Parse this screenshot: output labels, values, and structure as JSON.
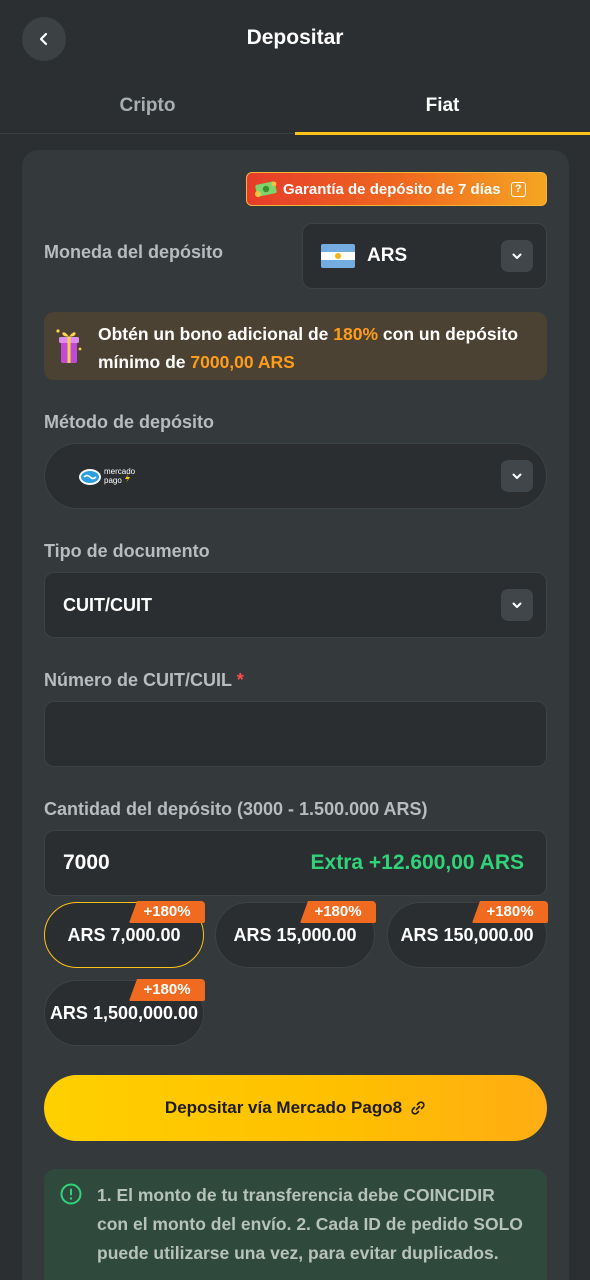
{
  "header": {
    "back_icon": "chevron-left-icon",
    "title": "Depositar"
  },
  "tabs": [
    {
      "label": "Cripto",
      "active": false
    },
    {
      "label": "Fiat",
      "active": true
    }
  ],
  "colors": {
    "accent": "#ffc21a",
    "bonus_highlight": "#ff9c1a",
    "extra_green": "#2fd47a",
    "required_star": "#ff4b4b"
  },
  "guarantee": {
    "icon": "money-icon",
    "text": "Garantía de depósito de 7 días",
    "help_icon": "?"
  },
  "currency": {
    "label": "Moneda del depósito",
    "flag_icon": "argentina-flag-icon",
    "value": "ARS"
  },
  "bonus": {
    "icon": "gift-icon",
    "text_pre": "Obtén un bono adicional de ",
    "percent": "180%",
    "text_mid": " con un depósito mínimo de ",
    "min_amount": "7000,00 ARS"
  },
  "method": {
    "label": "Método de depósito",
    "logo": "mercado-pago-logo",
    "logo_line1": "mercado",
    "logo_line2": "pago"
  },
  "document": {
    "label": "Tipo de documento",
    "value": "CUIT/CUIT"
  },
  "number": {
    "label": "Número de CUIT/CUIL",
    "required_mark": "*",
    "value": ""
  },
  "amount": {
    "label": "Cantidad del depósito (3000 - 1.500.000 ARS)",
    "value": "7000",
    "extra": "Extra +12.600,00 ARS"
  },
  "presets": [
    {
      "label": "ARS 7,000.00",
      "badge": "+180%",
      "selected": true
    },
    {
      "label": "ARS 15,000.00",
      "badge": "+180%",
      "selected": false
    },
    {
      "label": "ARS 150,000.00",
      "badge": "+180%",
      "selected": false
    },
    {
      "label": "ARS 1,500,000.00",
      "badge": "+180%",
      "selected": false
    }
  ],
  "deposit_button": {
    "label": "Depositar vía Mercado Pago8",
    "icon": "link-icon"
  },
  "notice": {
    "icon": "info-circle-icon",
    "text": "1. El monto de tu transferencia debe COINCIDIR con el monto del envío. 2. Cada ID de pedido SOLO puede utilizarse una vez, para evitar duplicados."
  }
}
